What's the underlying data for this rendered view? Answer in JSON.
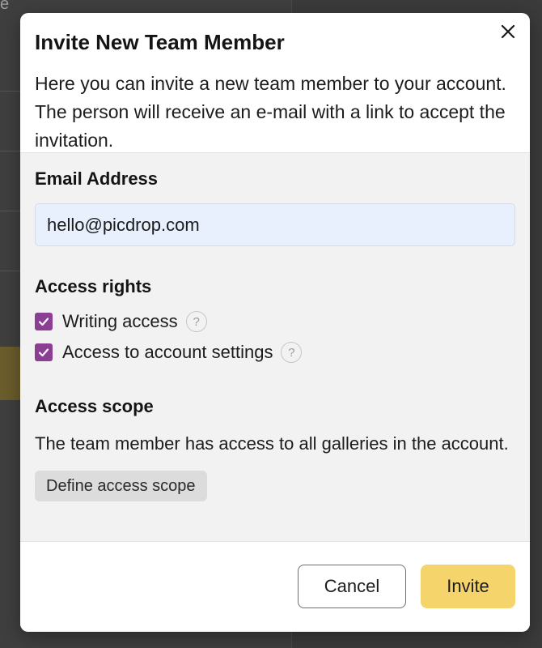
{
  "background": {
    "corner_text": "e"
  },
  "modal": {
    "title": "Invite New Team Member",
    "intro": "Here you can invite a new team member to your account. The person will receive an e-mail with a link to accept the invitation.",
    "email": {
      "label": "Email Address",
      "value": "hello@picdrop.com"
    },
    "access_rights": {
      "label": "Access rights",
      "options": [
        {
          "label": "Writing access",
          "checked": true
        },
        {
          "label": "Access to account settings",
          "checked": true
        }
      ],
      "help_glyph": "?"
    },
    "access_scope": {
      "label": "Access scope",
      "description": "The team member has access to all galleries in the account.",
      "button_label": "Define access scope"
    },
    "footer": {
      "cancel_label": "Cancel",
      "invite_label": "Invite"
    }
  },
  "colors": {
    "checkbox": "#8b3f93",
    "invite_button": "#f5d56b",
    "input_bg": "#e8f0fe"
  },
  "icons": {
    "close": "close-icon",
    "check": "checkmark-icon",
    "help": "help-icon"
  }
}
